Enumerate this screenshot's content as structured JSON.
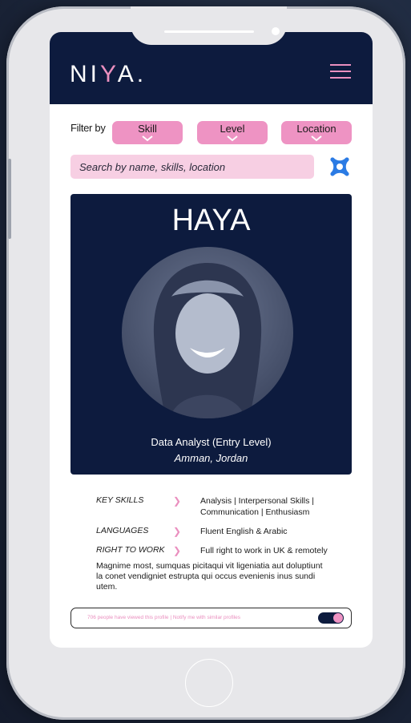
{
  "app": {
    "logo_left": "NI",
    "logo_accent": "Y",
    "logo_right": "A."
  },
  "filters": {
    "label": "Filter by",
    "options": [
      "Skill",
      "Level",
      "Location"
    ]
  },
  "search": {
    "placeholder": "Search by name, skills, location"
  },
  "profile": {
    "name": "HAYA",
    "title": "Data Analyst (Entry Level)",
    "location": "Amman, Jordan",
    "details": [
      {
        "label": "KEY SKILLS",
        "value": "Analysis | Interpersonal Skills | Communication  |  Enthusiasm"
      },
      {
        "label": "LANGUAGES",
        "value": "Fluent English & Arabic"
      },
      {
        "label": "RIGHT TO WORK",
        "value": "Full right to work in UK & remotely"
      }
    ],
    "description": "Magnime most, sumquas picitaqui vit ligeniatia aut doluptiunt la conet vendigniet estrupta qui occus evenienis inus sundi utem."
  },
  "notify": {
    "text": "706 people have viewed this profile |  Notify me with similar profiles",
    "toggle_on": true
  },
  "colors": {
    "navy": "#0d1b3e",
    "pink": "#ee93c3",
    "light_pink": "#f7cfe3",
    "accent_blue": "#2b7be4"
  }
}
